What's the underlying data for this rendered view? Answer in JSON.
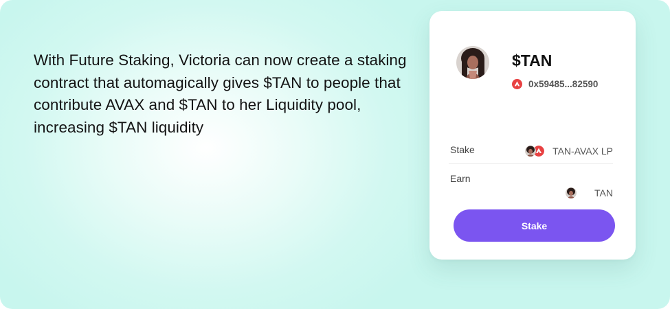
{
  "pitch": {
    "text": "With Future Staking, Victoria can now create a staking contract that automagically gives $TAN to people that contribute AVAX and $TAN to her Liquidity pool, increasing $TAN liquidity"
  },
  "card": {
    "token": "$TAN",
    "address": "0x59485...82590",
    "stake": {
      "label": "Stake",
      "asset": "TAN-AVAX LP"
    },
    "earn": {
      "label": "Earn",
      "asset": "TAN"
    },
    "button_label": "Stake",
    "icons": {
      "avatar": "profile-photo-avatar",
      "chain": "avalanche-icon",
      "stake_pair": [
        "tan-token-icon",
        "avalanche-icon"
      ],
      "earn_token": "tan-token-icon"
    }
  },
  "colors": {
    "background": "#cff8f0",
    "button": "#7b55f0",
    "avalanche": "#e84142"
  }
}
